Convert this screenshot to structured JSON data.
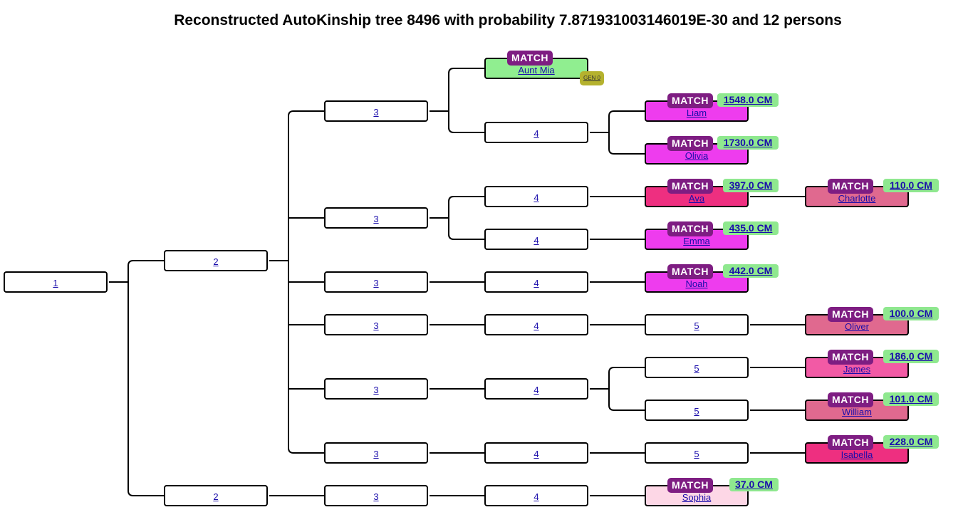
{
  "title": "Reconstructed AutoKinship tree 8496 with probability 7.87193100314601 9E-30 and 12 persons",
  "colors": {
    "aunt": "#90ee90",
    "magenta": "#ee3cee",
    "deep_pink": "#ee2f80",
    "rose": "#e0698f",
    "hot_pink": "#f25aa5",
    "light_pink": "#fdd7e6",
    "match": "#7e1d82",
    "cm": "#8fe88f",
    "gen": "#b5b22e"
  },
  "match_label": "MATCH",
  "nodes": [
    {
      "id": "n1",
      "label": "1"
    },
    {
      "id": "n2a",
      "label": "2"
    },
    {
      "id": "n2b",
      "label": "2"
    },
    {
      "id": "n3a",
      "label": "3"
    },
    {
      "id": "n3b",
      "label": "3"
    },
    {
      "id": "n3c",
      "label": "3"
    },
    {
      "id": "n3d",
      "label": "3"
    },
    {
      "id": "n3e",
      "label": "3"
    },
    {
      "id": "n3f",
      "label": "3"
    },
    {
      "id": "n3g",
      "label": "3"
    },
    {
      "id": "n4a",
      "label": "4"
    },
    {
      "id": "n4b",
      "label": "4"
    },
    {
      "id": "n4c",
      "label": "4"
    },
    {
      "id": "n4d",
      "label": "4"
    },
    {
      "id": "n4e",
      "label": "4"
    },
    {
      "id": "n4f",
      "label": "4"
    },
    {
      "id": "n4g",
      "label": "4"
    },
    {
      "id": "n4h",
      "label": "4"
    },
    {
      "id": "n5a",
      "label": "5"
    },
    {
      "id": "n5b",
      "label": "5"
    },
    {
      "id": "n5c",
      "label": "5"
    },
    {
      "id": "n5d",
      "label": "5"
    },
    {
      "id": "mia",
      "label": "Aunt Mia",
      "gen": "GEN 0"
    },
    {
      "id": "liam",
      "label": "Liam",
      "cm": "1548.0 CM"
    },
    {
      "id": "olivia",
      "label": "Olivia",
      "cm": "1730.0 CM"
    },
    {
      "id": "ava",
      "label": "Ava",
      "cm": "397.0 CM"
    },
    {
      "id": "emma",
      "label": "Emma",
      "cm": "435.0 CM"
    },
    {
      "id": "noah",
      "label": "Noah",
      "cm": "442.0 CM"
    },
    {
      "id": "sophia",
      "label": "Sophia",
      "cm": "37.0 CM"
    },
    {
      "id": "charlotte",
      "label": "Charlotte",
      "cm": "110.0 CM"
    },
    {
      "id": "oliver",
      "label": "Oliver",
      "cm": "100.0 CM"
    },
    {
      "id": "james",
      "label": "James",
      "cm": "186.0 CM"
    },
    {
      "id": "william",
      "label": "William",
      "cm": "101.0 CM"
    },
    {
      "id": "isabella",
      "label": "Isabella",
      "cm": "228.0 CM"
    }
  ]
}
